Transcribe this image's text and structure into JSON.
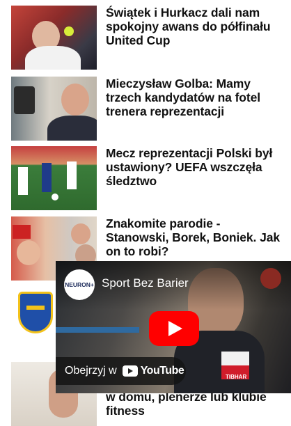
{
  "articles": [
    {
      "title": "Świątek i Hurkacz dali nam spokojny awans do półfinału United Cup"
    },
    {
      "title": "Mieczysław Golba: Mamy trzech kandydatów na fotel trenera reprezentacji"
    },
    {
      "title": "Mecz reprezentacji Polski był ustawiony? UEFA wszczęła śledztwo"
    },
    {
      "title": "Znakomite parodie - Stanowski, Borek, Boniek. Jak on to robi?"
    },
    {
      "title": ""
    },
    {
      "title": "w domu, plenerze lub klubie fitness"
    }
  ],
  "video": {
    "channel_logo_text": "NEURON+",
    "title": "Sport Bez Barier",
    "watch_label": "Obejrzyj w",
    "youtube_word": "YouTube",
    "jersey_text": "TIBHAR",
    "brand_color": "#ff0000"
  }
}
